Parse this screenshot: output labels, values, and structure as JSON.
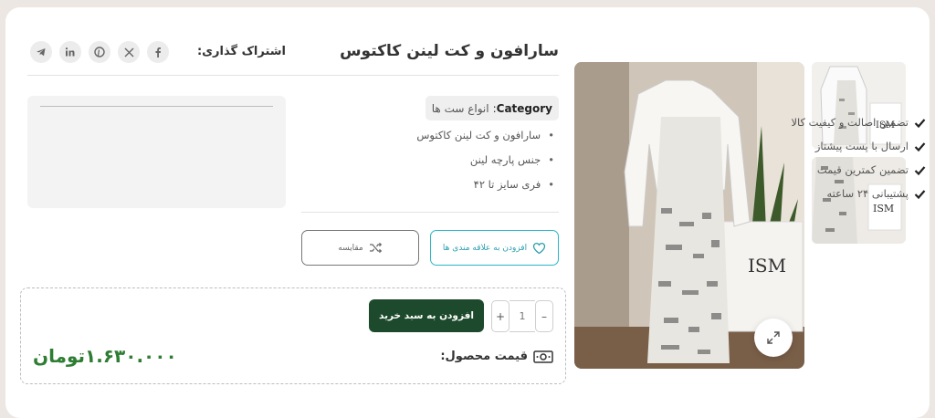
{
  "product": {
    "title": "سارافون و کت لینن کاکتوس",
    "category_key": "Category",
    "category_colon": ":",
    "category_value": "انواع ست ها",
    "features": [
      "سارافون و کت لینن کاکتوس",
      "جنس پارچه لینن",
      "فری سایز تا ۴۲"
    ]
  },
  "share": {
    "label": "اشتراک گذاری:",
    "icons": [
      "facebook-icon",
      "x-icon",
      "pinterest-icon",
      "linkedin-icon",
      "telegram-icon"
    ]
  },
  "guarantees": [
    "تضمین اصالت و کیفیت کالا",
    "ارسال با پست پیشتاز",
    "تضمین کمترین قیمت",
    "پشتیبانی ۲۴ ساعته"
  ],
  "actions": {
    "wishlist_label": "افزودن به علاقه مندی ها",
    "compare_label": "مقایسه",
    "add_to_cart_label": "افزودن به سبد خرید"
  },
  "quantity": {
    "value": "1",
    "minus": "–",
    "plus": "+"
  },
  "price": {
    "label": "قیمت محصول:",
    "value": "۱.۶۳۰.۰۰۰تومان"
  },
  "colors": {
    "primary_green": "#1d4a2c",
    "price_green": "#2e7d32",
    "wishlist_accent": "#29b6c9"
  }
}
